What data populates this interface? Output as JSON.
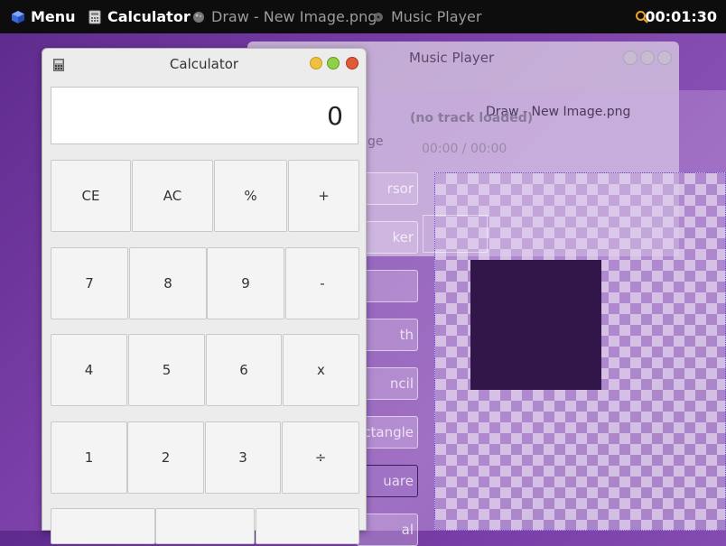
{
  "taskbar": {
    "menu_label": "Menu",
    "items": [
      {
        "label": "Calculator",
        "active": true
      },
      {
        "label": "Draw - New Image.png",
        "active": false
      },
      {
        "label": "Music Player",
        "active": false
      }
    ],
    "clock": "00:01:30"
  },
  "music_player": {
    "title": "Music Player",
    "track": "(no track loaded)",
    "time": "00:00 / 00:00"
  },
  "draw": {
    "title": "Draw - New Image.png",
    "partial_label": "ge",
    "tools": [
      "rsor",
      "ker",
      "",
      "th",
      "ncil",
      "ctangle",
      "uare",
      "al"
    ]
  },
  "calculator": {
    "title": "Calculator",
    "display": "0",
    "rows": [
      [
        "CE",
        "AC",
        "%",
        "+"
      ],
      [
        "7",
        "8",
        "9",
        "-"
      ],
      [
        "4",
        "5",
        "6",
        "x"
      ],
      [
        "1",
        "2",
        "3",
        "÷"
      ]
    ]
  },
  "colors": {
    "taskbar_bg": "#0d0d0d",
    "desktop_purple": "#7a3fa8",
    "btn_min": "#f0c040",
    "btn_max": "#8fd048",
    "btn_close": "#e05a3a"
  }
}
